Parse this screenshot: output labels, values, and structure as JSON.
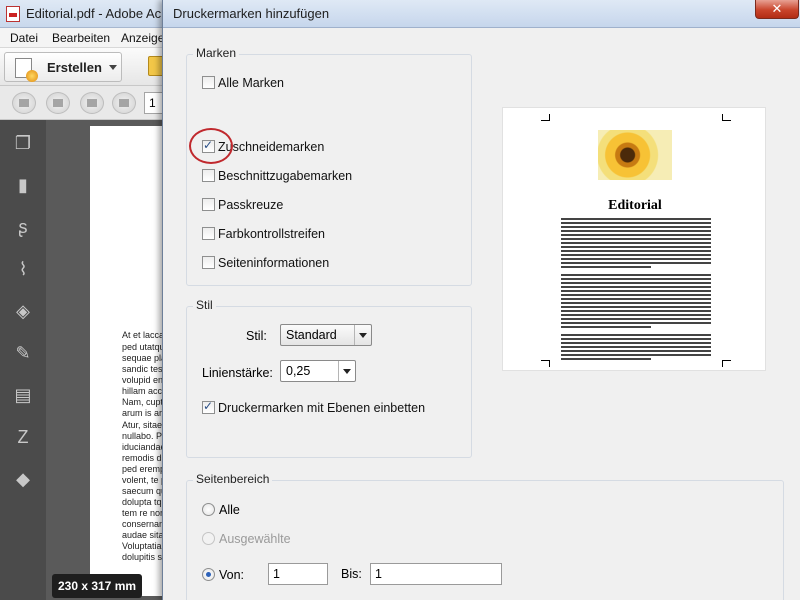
{
  "acrobat": {
    "title": "Editorial.pdf - Adobe Acro",
    "menu": [
      "Datei",
      "Bearbeiten",
      "Anzeige"
    ],
    "create_label": "Erstellen",
    "page_number": "1",
    "doc_lines": [
      "At et laccae m",
      "ped utatquam",
      "sequae plam",
      "sandic tessim",
      "volupid endi",
      "hillam accum",
      "Nam, cuptat",
      "arum is arciat",
      "Atur, sitaecus",
      "nullabo. Pudit",
      "iduciandae eli",
      "remodis dissim",
      "ped erempe",
      "volent, te pra",
      "saecum quia",
      "dolupta tquo",
      "tem re nonse",
      "consernam fu",
      "audae sitatur",
      "Voluptatia cu",
      "dolupitis si d"
    ],
    "size_badge": "230 x 317 mm"
  },
  "dialog": {
    "title": "Druckermarken hinzufügen",
    "close_icon": "close-icon",
    "marken": {
      "legend": "Marken",
      "items": [
        {
          "label": "Alle Marken",
          "checked": false
        },
        {
          "label": "Zuschneidemarken",
          "checked": true
        },
        {
          "label": "Beschnittzugabemarken",
          "checked": false
        },
        {
          "label": "Passkreuze",
          "checked": false
        },
        {
          "label": "Farbkontrollstreifen",
          "checked": false
        },
        {
          "label": "Seiteninformationen",
          "checked": false
        }
      ]
    },
    "stil": {
      "legend": "Stil",
      "stil_label": "Stil:",
      "stil_value": "Standard",
      "linien_label": "Linienstärke:",
      "linien_value": "0,25",
      "embed_label": "Druckermarken mit Ebenen einbetten",
      "embed_checked": true
    },
    "seitenbereich": {
      "legend": "Seitenbereich",
      "alle": "Alle",
      "ausgewaehlte": "Ausgewählte",
      "von": "Von:",
      "von_value": "1",
      "bis": "Bis:",
      "bis_value": "1",
      "selected": "von"
    },
    "preview": {
      "title": "Editorial"
    }
  },
  "colors": {
    "highlight": "#c0282d",
    "checkmark": "#2b4f86",
    "sidebar": "#4b4b4b"
  }
}
